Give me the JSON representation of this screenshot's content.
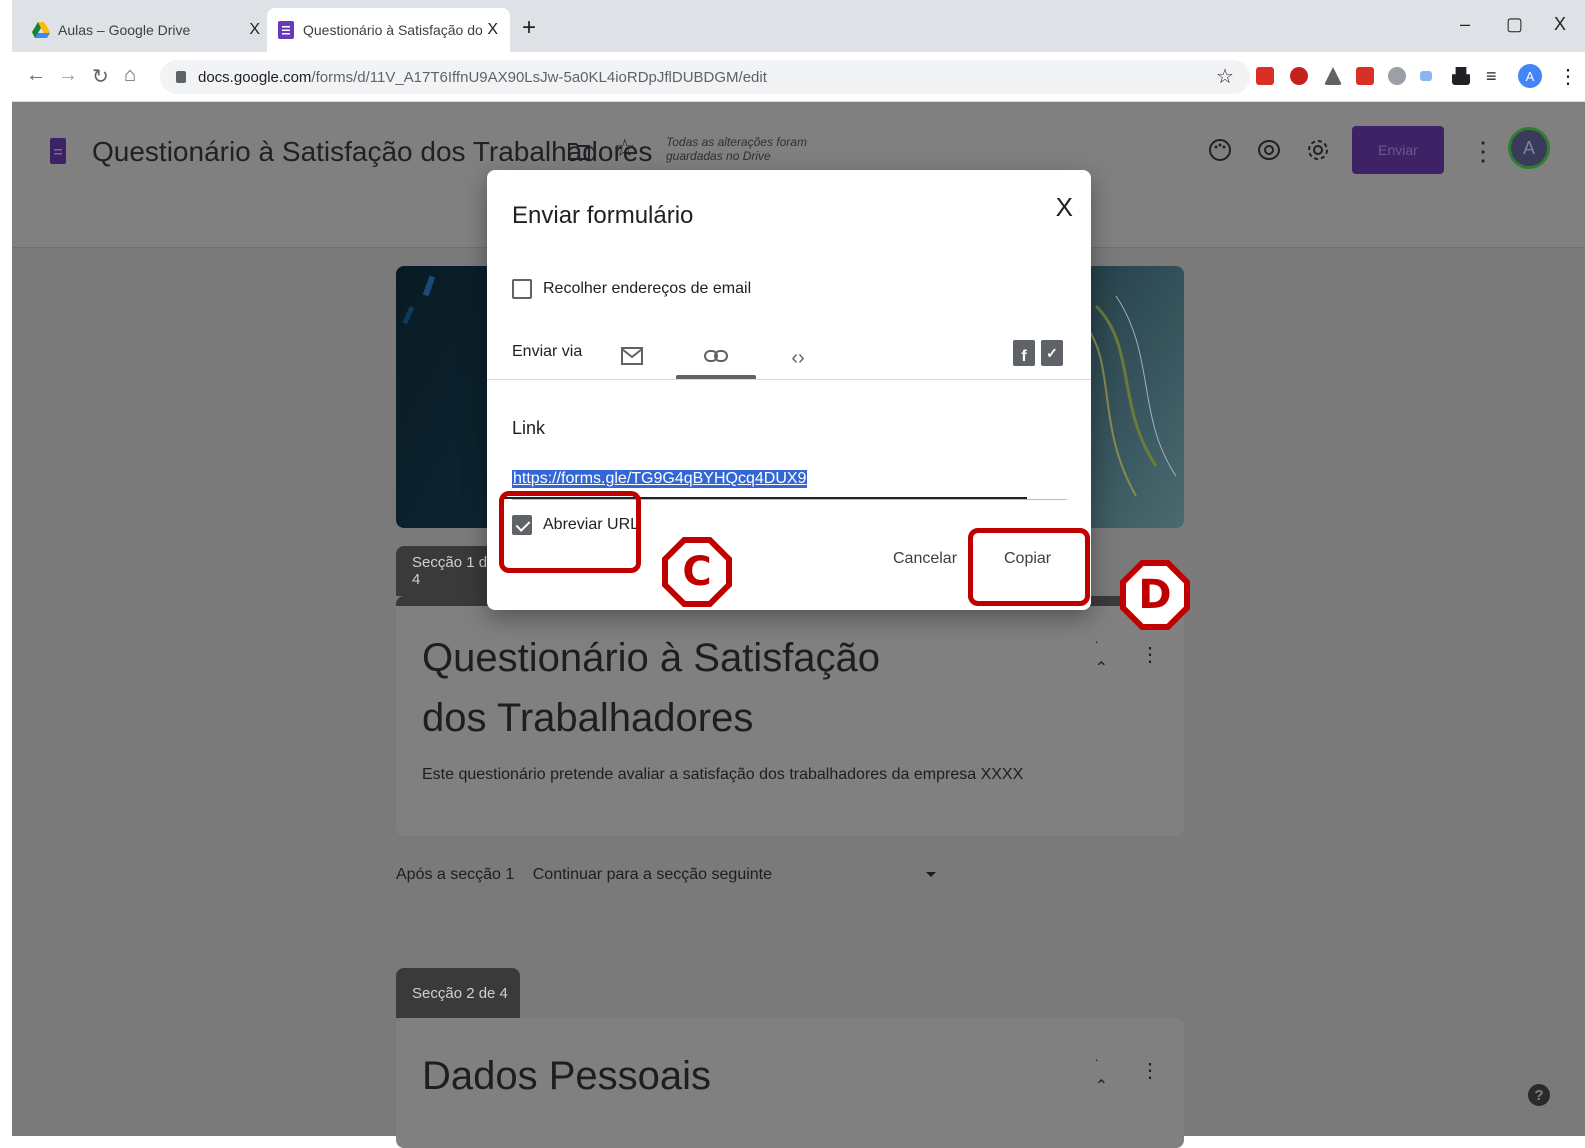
{
  "browser": {
    "tabs": [
      {
        "title": "Aulas – Google Drive",
        "close": "X"
      },
      {
        "title": "Questionário à Satisfação dos Tra",
        "close": "X"
      }
    ],
    "new_tab": "+",
    "window_controls": {
      "minimize": "–",
      "maximize": "▢",
      "close": "X"
    },
    "url_host": "docs.google.com",
    "url_path": "/forms/d/11V_A17T6IffnU9AX90LsJw-5a0KL4ioRDpJflDUBDGM/edit",
    "profile_initial": "A",
    "icons": {
      "back": "arrow-left-icon",
      "forward": "arrow-right-icon",
      "reload": "reload-icon",
      "home": "home-icon",
      "star": "star-icon"
    }
  },
  "form_header": {
    "title": "Questionário à Satisfação dos Trabalhadores",
    "saved_status": "Todas as alterações foram guardadas no Drive",
    "send_button": "Enviar",
    "avatar_initial": "A"
  },
  "section1": {
    "tab_label": "Secção 1 de 4",
    "title": "Questionário à Satisfação dos Trabalhadores",
    "description": "Este questionário pretende avaliar a satisfação dos trabalhadores da empresa XXXX"
  },
  "after_section": {
    "label": "Após a secção 1",
    "selected": "Continuar para a secção seguinte"
  },
  "section2": {
    "tab_label": "Secção 2 de 4",
    "title": "Dados Pessoais"
  },
  "dialog": {
    "title": "Enviar formulário",
    "close": "X",
    "collect_emails_label": "Recolher endereços de email",
    "collect_emails_checked": false,
    "send_via_label": "Enviar via",
    "active_tab": "link",
    "link_label": "Link",
    "link_value": "https://forms.gle/TG9G4qBYHQcq4DUX9",
    "shorten_url_label": "Abreviar URL",
    "shorten_url_checked": true,
    "cancel_button": "Cancelar",
    "copy_button": "Copiar"
  },
  "annotations": {
    "c_label": "C",
    "d_label": "D",
    "color": "#c00000"
  },
  "help": "?"
}
